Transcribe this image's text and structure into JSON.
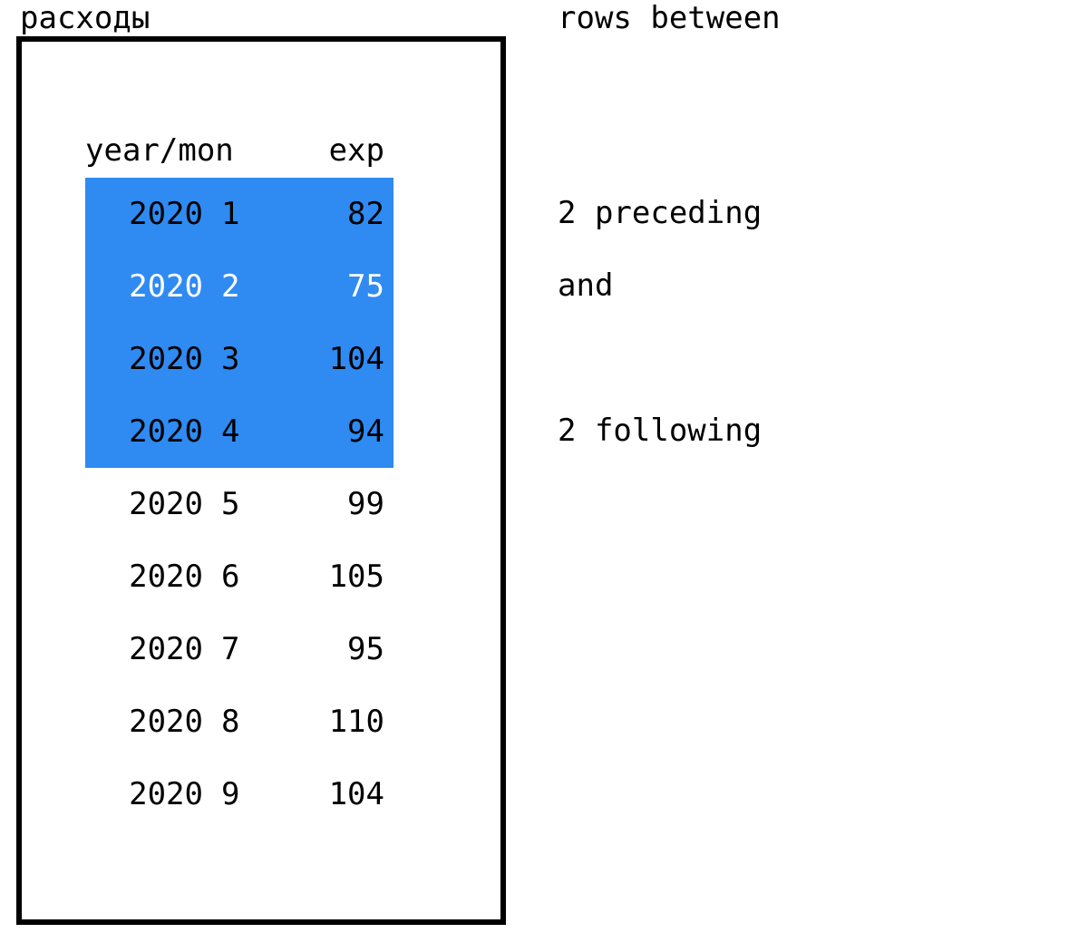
{
  "titles": {
    "left": "расходы",
    "right": "rows between"
  },
  "headers": {
    "year_mon": "year/mon",
    "exp": "exp"
  },
  "rows": [
    {
      "year": "2020",
      "mon": "1",
      "exp": "82",
      "hl": true,
      "current": false
    },
    {
      "year": "2020",
      "mon": "2",
      "exp": "75",
      "hl": true,
      "current": true
    },
    {
      "year": "2020",
      "mon": "3",
      "exp": "104",
      "hl": true,
      "current": false
    },
    {
      "year": "2020",
      "mon": "4",
      "exp": "94",
      "hl": true,
      "current": false
    },
    {
      "year": "2020",
      "mon": "5",
      "exp": "99",
      "hl": false,
      "current": false
    },
    {
      "year": "2020",
      "mon": "6",
      "exp": "105",
      "hl": false,
      "current": false
    },
    {
      "year": "2020",
      "mon": "7",
      "exp": "95",
      "hl": false,
      "current": false
    },
    {
      "year": "2020",
      "mon": "8",
      "exp": "110",
      "hl": false,
      "current": false
    },
    {
      "year": "2020",
      "mon": "9",
      "exp": "104",
      "hl": false,
      "current": false
    }
  ],
  "annotations": {
    "preceding": "2 preceding",
    "and": "and",
    "following": "2 following"
  },
  "chart_data": {
    "type": "table",
    "columns": [
      "year",
      "mon",
      "exp"
    ],
    "data": [
      [
        2020,
        1,
        82
      ],
      [
        2020,
        2,
        75
      ],
      [
        2020,
        3,
        104
      ],
      [
        2020,
        4,
        94
      ],
      [
        2020,
        5,
        99
      ],
      [
        2020,
        6,
        105
      ],
      [
        2020,
        7,
        95
      ],
      [
        2020,
        8,
        110
      ],
      [
        2020,
        9,
        104
      ]
    ],
    "highlight_range": {
      "start_index": 0,
      "end_index": 3
    },
    "current_row_index": 1,
    "frame_spec": "rows between 2 preceding and 2 following"
  }
}
